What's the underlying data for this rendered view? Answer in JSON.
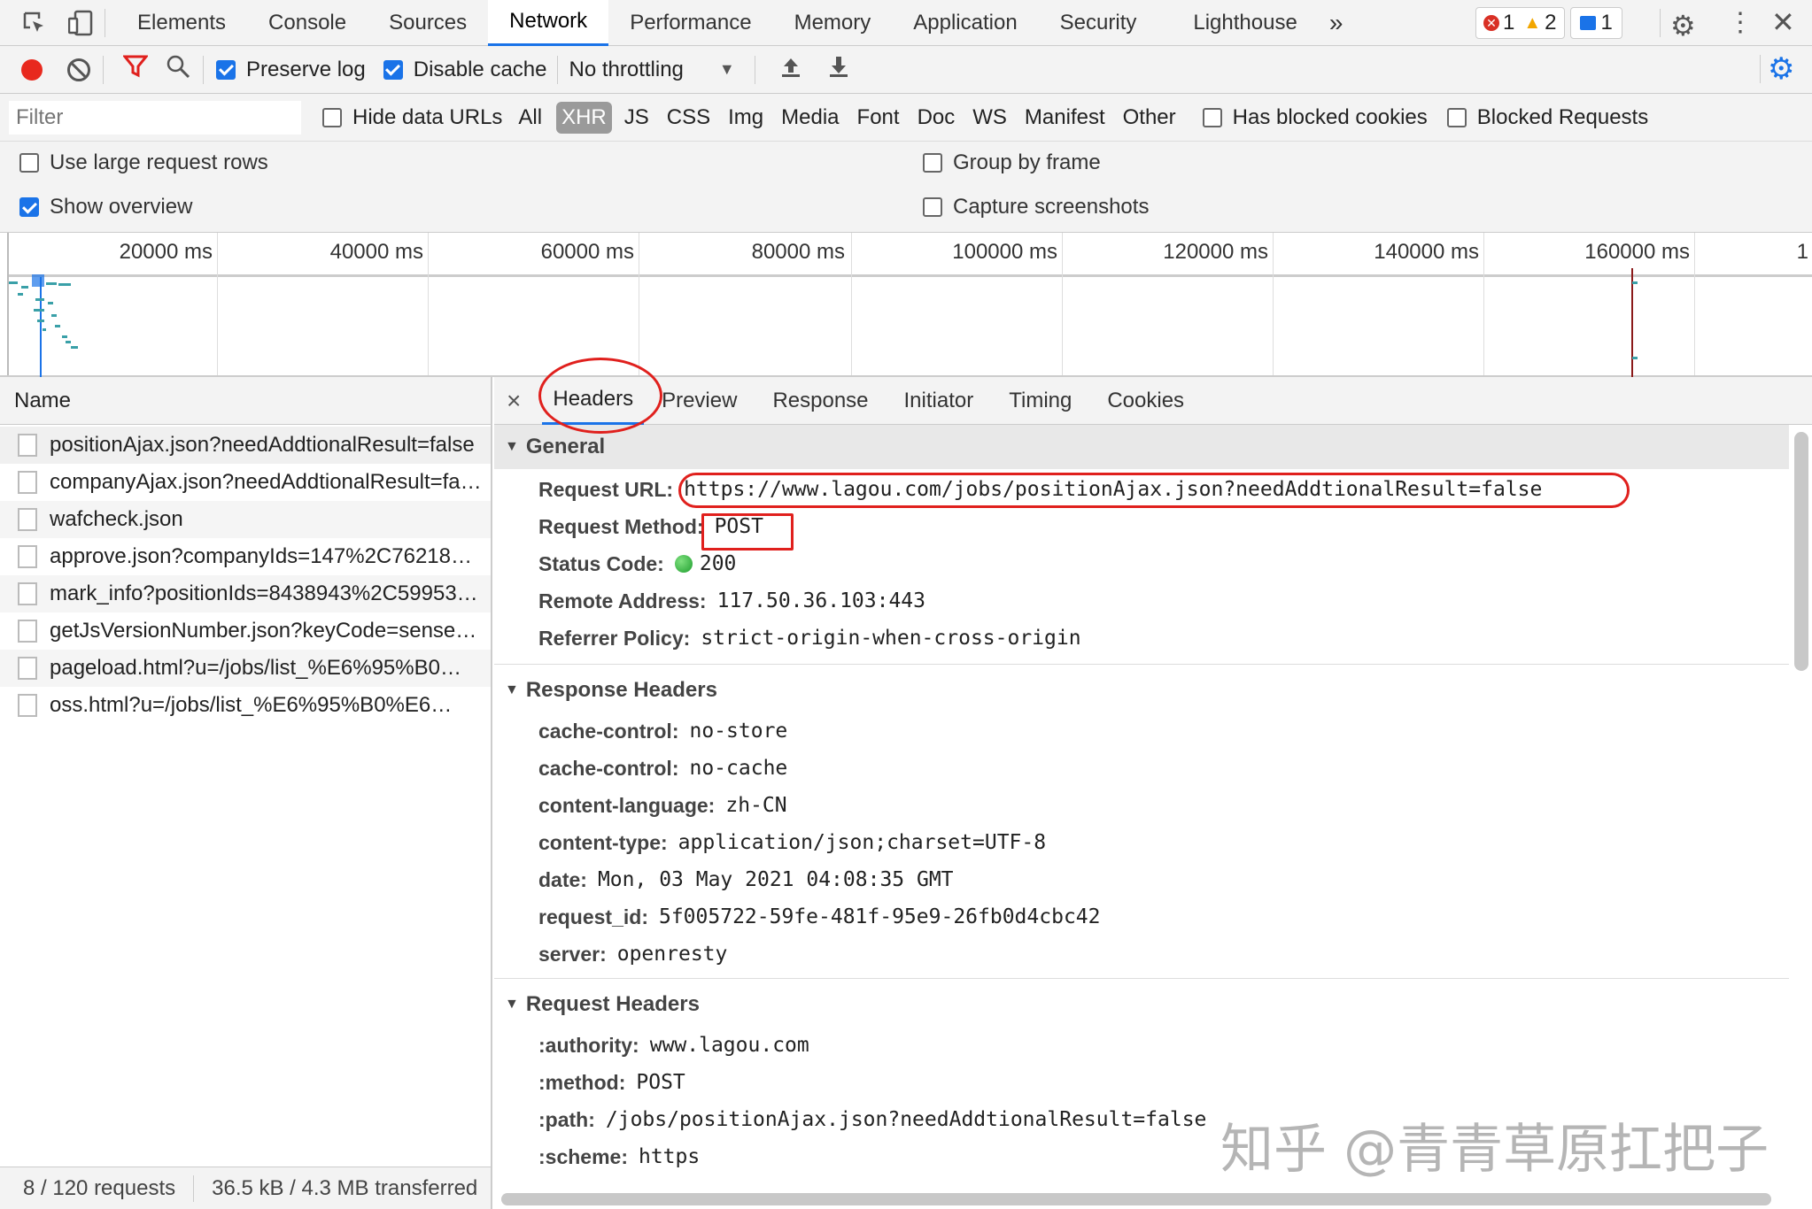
{
  "tabs": [
    "Elements",
    "Console",
    "Sources",
    "Network",
    "Performance",
    "Memory",
    "Application",
    "Security",
    "Lighthouse"
  ],
  "more": "»",
  "badges": {
    "errors": "1",
    "warnings": "2",
    "messages": "1"
  },
  "toolbar": {
    "preserve_log": "Preserve log",
    "disable_cache": "Disable cache",
    "throttling": "No throttling"
  },
  "filter": {
    "placeholder": "Filter",
    "hide_data_urls": "Hide data URLs",
    "types": [
      "All",
      "XHR",
      "JS",
      "CSS",
      "Img",
      "Media",
      "Font",
      "Doc",
      "WS",
      "Manifest",
      "Other"
    ],
    "has_blocked_cookies": "Has blocked cookies",
    "blocked_requests": "Blocked Requests"
  },
  "options": {
    "large_rows": "Use large request rows",
    "show_overview": "Show overview",
    "group_by_frame": "Group by frame",
    "capture_screenshots": "Capture screenshots"
  },
  "timeline": {
    "ticks": [
      "20000 ms",
      "40000 ms",
      "60000 ms",
      "80000 ms",
      "100000 ms",
      "120000 ms",
      "140000 ms",
      "160000 ms",
      "1"
    ]
  },
  "list": {
    "header": "Name",
    "items": [
      "positionAjax.json?needAddtionalResult=false",
      "companyAjax.json?needAddtionalResult=fa…",
      "wafcheck.json",
      "approve.json?companyIds=147%2C76218…",
      "mark_info?positionIds=8438943%2C59953…",
      "getJsVersionNumber.json?keyCode=sense…",
      "pageload.html?u=/jobs/list_%E6%95%B0…",
      "oss.html?u=/jobs/list_%E6%95%B0%E6…"
    ],
    "footer_requests": "8 / 120 requests",
    "footer_transferred": "36.5 kB / 4.3 MB transferred"
  },
  "detail": {
    "close": "×",
    "tabs": [
      "Headers",
      "Preview",
      "Response",
      "Initiator",
      "Timing",
      "Cookies"
    ]
  },
  "general": {
    "title": "General",
    "rows": [
      {
        "k": "Request URL:",
        "v": "https://www.lagou.com/jobs/positionAjax.json?needAddtionalResult=false"
      },
      {
        "k": "Request Method:",
        "v": "POST"
      },
      {
        "k": "Status Code:",
        "v": "200"
      },
      {
        "k": "Remote Address:",
        "v": "117.50.36.103:443"
      },
      {
        "k": "Referrer Policy:",
        "v": "strict-origin-when-cross-origin"
      }
    ]
  },
  "response_headers": {
    "title": "Response Headers",
    "rows": [
      {
        "k": "cache-control:",
        "v": "no-store"
      },
      {
        "k": "cache-control:",
        "v": "no-cache"
      },
      {
        "k": "content-language:",
        "v": "zh-CN"
      },
      {
        "k": "content-type:",
        "v": "application/json;charset=UTF-8"
      },
      {
        "k": "date:",
        "v": "Mon, 03 May 2021 04:08:35 GMT"
      },
      {
        "k": "request_id:",
        "v": "5f005722-59fe-481f-95e9-26fb0d4cbc42"
      },
      {
        "k": "server:",
        "v": "openresty"
      }
    ]
  },
  "request_headers": {
    "title": "Request Headers",
    "rows": [
      {
        "k": ":authority:",
        "v": "www.lagou.com"
      },
      {
        "k": ":method:",
        "v": "POST"
      },
      {
        "k": ":path:",
        "v": "/jobs/positionAjax.json?needAddtionalResult=false"
      },
      {
        "k": ":scheme:",
        "v": "https"
      }
    ]
  },
  "watermark": "知乎 @青青草原扛把子"
}
